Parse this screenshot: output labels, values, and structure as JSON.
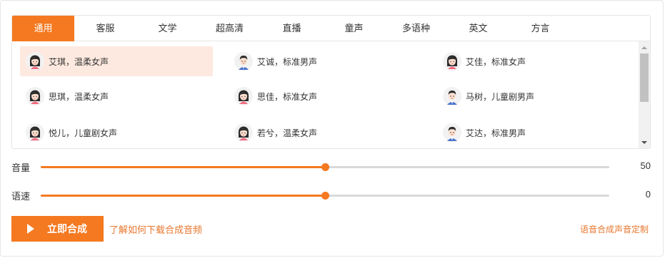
{
  "tabs": [
    {
      "label": "通用",
      "active": true
    },
    {
      "label": "客服",
      "active": false
    },
    {
      "label": "文学",
      "active": false
    },
    {
      "label": "超高清",
      "active": false
    },
    {
      "label": "直播",
      "active": false
    },
    {
      "label": "童声",
      "active": false
    },
    {
      "label": "多语种",
      "active": false
    },
    {
      "label": "英文",
      "active": false
    },
    {
      "label": "方言",
      "active": false
    }
  ],
  "voices": [
    {
      "label": "艾琪，温柔女声",
      "avatar": "female-avatar-icon",
      "selected": true
    },
    {
      "label": "艾诚，标准男声",
      "avatar": "male-avatar-icon",
      "selected": false
    },
    {
      "label": "艾佳，标准女声",
      "avatar": "female-avatar-icon",
      "selected": false
    },
    {
      "label": "思琪，温柔女声",
      "avatar": "female-avatar-icon",
      "selected": false
    },
    {
      "label": "思佳，标准女声",
      "avatar": "female-avatar-icon",
      "selected": false
    },
    {
      "label": "马树，儿童剧男声",
      "avatar": "male-avatar-icon",
      "selected": false
    },
    {
      "label": "悦儿，儿童剧女声",
      "avatar": "female-avatar-icon",
      "selected": false
    },
    {
      "label": "若兮，温柔女声",
      "avatar": "female-avatar-icon",
      "selected": false
    },
    {
      "label": "艾达，标准男声",
      "avatar": "male-avatar-icon",
      "selected": false
    }
  ],
  "volume": {
    "label": "音量",
    "value": "50",
    "fraction": 0.5
  },
  "speed": {
    "label": "语速",
    "value": "0",
    "fraction": 0.5
  },
  "actions": {
    "synthesize": "立即合成",
    "download_help": "了解如何下载合成音频",
    "custom_voice": "语音合成声音定制"
  },
  "colors": {
    "accent": "#f47920",
    "selected_bg": "#fde9df",
    "link": "#e8772e"
  }
}
